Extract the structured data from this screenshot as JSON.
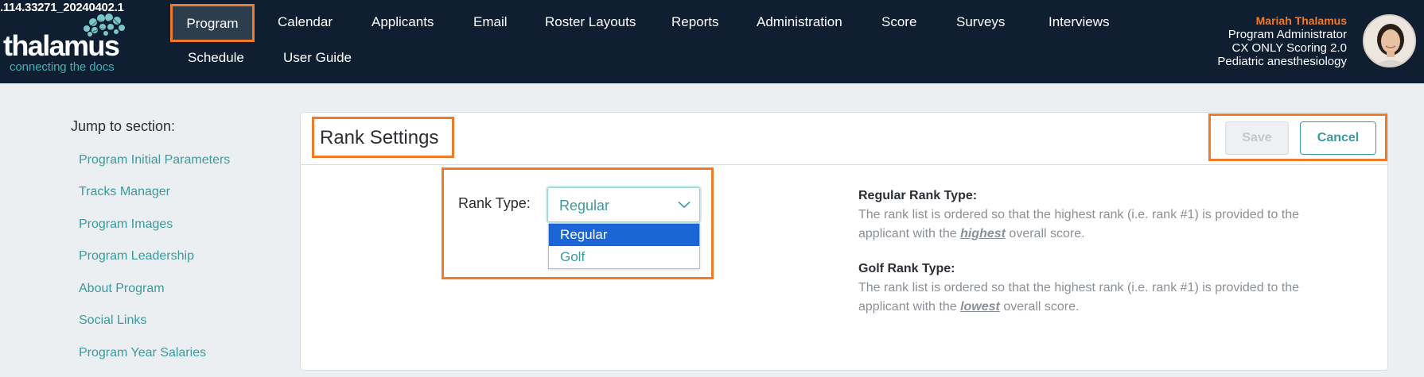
{
  "header": {
    "version": ".114.33271_20240402.1",
    "logo_word": "thalamus",
    "logo_tagline": "connecting the docs",
    "nav": [
      {
        "label": "Program",
        "active": true
      },
      {
        "label": "Calendar"
      },
      {
        "label": "Applicants"
      },
      {
        "label": "Email"
      },
      {
        "label": "Roster Layouts"
      },
      {
        "label": "Reports"
      },
      {
        "label": "Administration"
      },
      {
        "label": "Score"
      },
      {
        "label": "Surveys"
      },
      {
        "label": "Interviews"
      },
      {
        "label": "Schedule"
      },
      {
        "label": "User Guide"
      }
    ],
    "user": {
      "name": "Mariah Thalamus",
      "role": "Program Administrator",
      "org": "CX ONLY Scoring 2.0",
      "specialty": "Pediatric anesthesiology"
    },
    "colors": {
      "bg": "#0f1e30",
      "accent": "#f07a28",
      "teal": "#3fb3b8"
    }
  },
  "sidebar": {
    "title": "Jump to section:",
    "links": [
      "Program Initial Parameters",
      "Tracks Manager",
      "Program Images",
      "Program Leadership",
      "About Program",
      "Social Links",
      "Program Year Salaries"
    ]
  },
  "card": {
    "title": "Rank Settings",
    "save_label": "Save",
    "cancel_label": "Cancel",
    "rank_type_label": "Rank Type:",
    "rank_type_value": "Regular",
    "options": [
      "Regular",
      "Golf"
    ],
    "regular": {
      "heading": "Regular Rank Type:",
      "line1": "The rank list is ordered so that the highest rank (i.e. rank #1) is provided to the",
      "line2_pre": "applicant with the ",
      "line2_em": "highest",
      "line2_post": " overall score."
    },
    "golf": {
      "heading": "Golf Rank Type:",
      "line1": "The rank list is ordered so that the highest rank (i.e. rank #1) is provided to the",
      "line2_pre": "applicant with the ",
      "line2_em": "lowest",
      "line2_post": " overall score."
    }
  }
}
